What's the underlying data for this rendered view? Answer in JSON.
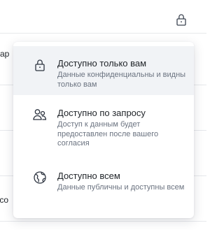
{
  "background": {
    "row1_text": "rap",
    "row4_text": ".co"
  },
  "access_menu": {
    "options": [
      {
        "title": "Доступно только вам",
        "description": "Данные конфиденциальны и видны только вам",
        "icon": "lock-icon",
        "selected": true
      },
      {
        "title": "Доступно по запросу",
        "description": "Доступ к данным будет предоставлен после вашего согласия",
        "icon": "users-icon",
        "selected": false
      },
      {
        "title": "Доступно всем",
        "description": "Данные публичны и доступны всем",
        "icon": "globe-icon",
        "selected": false
      }
    ]
  },
  "colors": {
    "selected_bg": "#f1f3f6",
    "text": "#1f2328",
    "muted_text": "#6b7380"
  }
}
